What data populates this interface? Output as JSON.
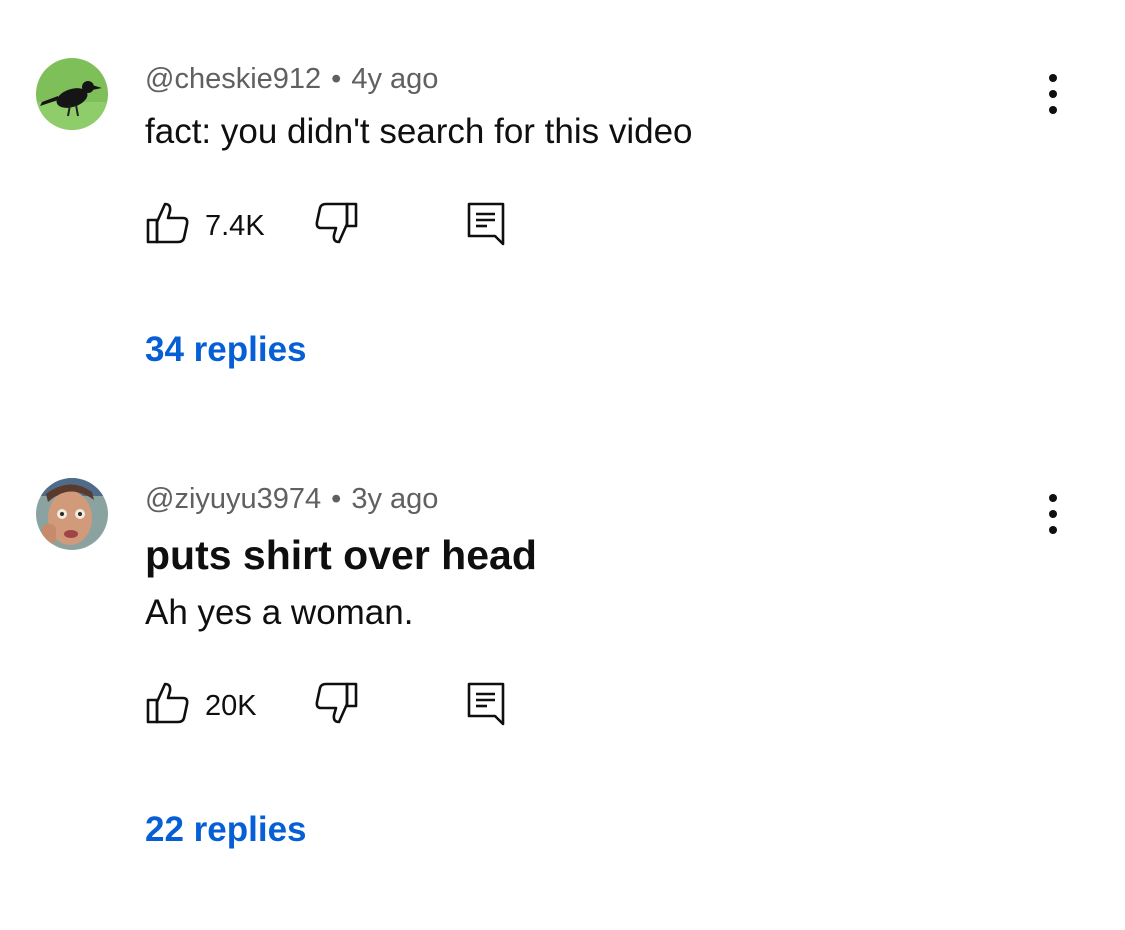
{
  "comments": [
    {
      "author": "@cheskie912",
      "separator": "•",
      "time": "4y ago",
      "text": "fact: you didn't search for this video",
      "likes": "7.4K",
      "replies_label": "34 replies",
      "avatar_icon": "crow-avatar"
    },
    {
      "author": "@ziyuyu3974",
      "separator": "•",
      "time": "3y ago",
      "bold_text": "puts shirt over head",
      "text": "Ah yes a woman.",
      "likes": "20K",
      "replies_label": "22 replies",
      "avatar_icon": "painted-face-avatar"
    }
  ],
  "colors": {
    "link_blue": "#065fd4",
    "meta_gray": "#606060",
    "text": "#0f0f0f"
  },
  "icons": [
    "thumbs-up-icon",
    "thumbs-down-icon",
    "reply-icon",
    "more-vertical-icon"
  ]
}
